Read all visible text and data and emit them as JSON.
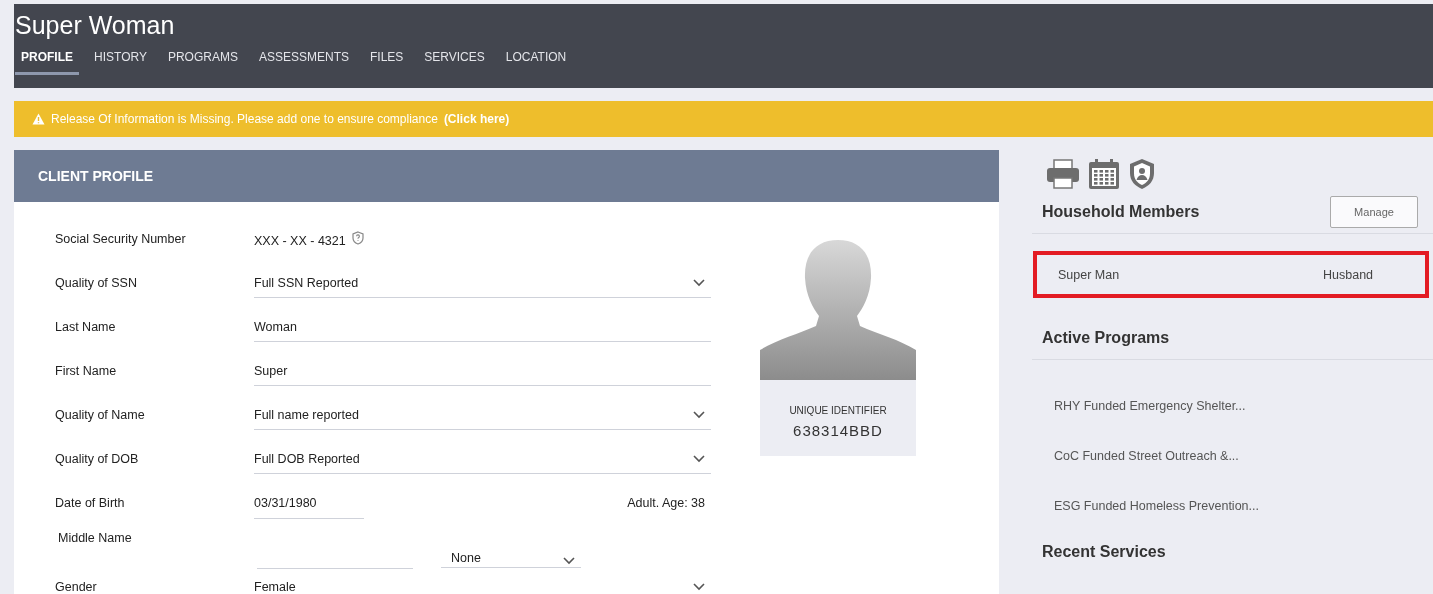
{
  "title": "Super Woman",
  "tabs": [
    {
      "label": "PROFILE",
      "selected": true
    },
    {
      "label": "HISTORY",
      "selected": false
    },
    {
      "label": "PROGRAMS",
      "selected": false
    },
    {
      "label": "ASSESSMENTS",
      "selected": false
    },
    {
      "label": "FILES",
      "selected": false
    },
    {
      "label": "SERVICES",
      "selected": false
    },
    {
      "label": "LOCATION",
      "selected": false
    }
  ],
  "alert": {
    "message": "Release Of Information is Missing. Please add one to ensure compliance",
    "link": "(Click here)"
  },
  "client_profile": {
    "title": "CLIENT PROFILE",
    "fields": [
      {
        "kind": "masked",
        "label": "Social Security Number",
        "value": "XXX - XX - 4321"
      },
      {
        "kind": "select",
        "label": "Quality of SSN",
        "value": "Full SSN Reported"
      },
      {
        "kind": "input",
        "label": "Last Name",
        "value": "Woman"
      },
      {
        "kind": "input",
        "label": "First Name",
        "value": "Super"
      },
      {
        "kind": "select",
        "label": "Quality of Name",
        "value": "Full name reported"
      },
      {
        "kind": "select",
        "label": "Quality of DOB",
        "value": "Full DOB Reported"
      },
      {
        "kind": "date",
        "label": "Date of Birth",
        "value": "03/31/1980",
        "note": "Adult. Age: 38"
      },
      {
        "kind": "split",
        "label": "Middle Name",
        "suffix": "None"
      },
      {
        "kind": "select",
        "label": "Gender",
        "value": "Female"
      }
    ],
    "photo": {
      "caption": "UNIQUE IDENTIFIER",
      "identifier": "638314BBD"
    }
  },
  "household": {
    "title": "Household Members",
    "button": "Manage",
    "members": [
      {
        "name": "Super Man",
        "relation": "Husband",
        "highlighted": true
      }
    ]
  },
  "active_programs": {
    "title": "Active Programs",
    "items": [
      "RHY Funded Emergency Shelter...",
      "CoC Funded Street Outreach &...",
      "ESG Funded Homeless Prevention..."
    ]
  },
  "recent_services": {
    "title": "Recent Services"
  }
}
